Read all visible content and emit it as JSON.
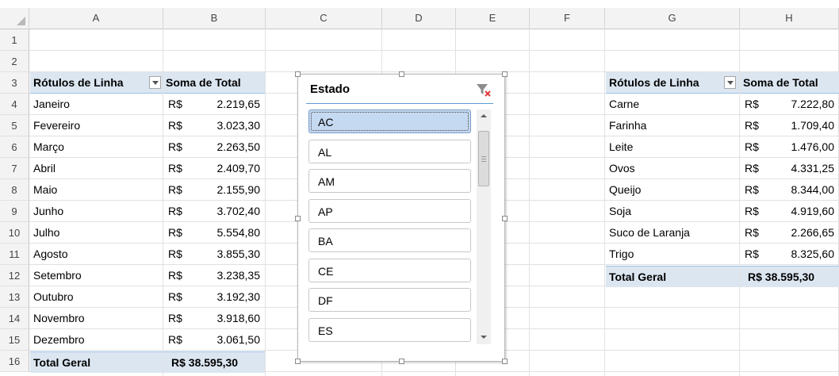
{
  "columns": [
    "A",
    "B",
    "C",
    "D",
    "E",
    "F",
    "G",
    "H"
  ],
  "rows": [
    "1",
    "2",
    "3",
    "4",
    "5",
    "6",
    "7",
    "8",
    "9",
    "10",
    "11",
    "12",
    "13",
    "14",
    "15",
    "16"
  ],
  "pivot_months": {
    "header_label": "Rótulos de Linha",
    "header_value": "Soma de Total",
    "currency": "R$",
    "items": [
      {
        "label": "Janeiro",
        "value": "2.219,65"
      },
      {
        "label": "Fevereiro",
        "value": "3.023,30"
      },
      {
        "label": "Março",
        "value": "2.263,50"
      },
      {
        "label": "Abril",
        "value": "2.409,70"
      },
      {
        "label": "Maio",
        "value": "2.155,90"
      },
      {
        "label": "Junho",
        "value": "3.702,40"
      },
      {
        "label": "Julho",
        "value": "5.554,80"
      },
      {
        "label": "Agosto",
        "value": "3.855,30"
      },
      {
        "label": "Setembro",
        "value": "3.238,35"
      },
      {
        "label": "Outubro",
        "value": "3.192,30"
      },
      {
        "label": "Novembro",
        "value": "3.918,60"
      },
      {
        "label": "Dezembro",
        "value": "3.061,50"
      }
    ],
    "total_label": "Total Geral",
    "total_value": "R$  38.595,30"
  },
  "pivot_products": {
    "header_label": "Rótulos de Linha",
    "header_value": "Soma de Total",
    "currency": "R$",
    "items": [
      {
        "label": "Carne",
        "value": "7.222,80"
      },
      {
        "label": "Farinha",
        "value": "1.709,40"
      },
      {
        "label": "Leite",
        "value": "1.476,00"
      },
      {
        "label": "Ovos",
        "value": "4.331,25"
      },
      {
        "label": "Queijo",
        "value": "8.344,00"
      },
      {
        "label": "Soja",
        "value": "4.919,60"
      },
      {
        "label": "Suco de Laranja",
        "value": "2.266,65"
      },
      {
        "label": "Trigo",
        "value": "8.325,60"
      }
    ],
    "total_label": "Total Geral",
    "total_value": "R$  38.595,30"
  },
  "slicer": {
    "title": "Estado",
    "selected": "AC",
    "items": [
      "AC",
      "AL",
      "AM",
      "AP",
      "BA",
      "CE",
      "DF",
      "ES"
    ]
  },
  "icons": {
    "clear_filter": "clear-filter-icon",
    "dropdown": "dropdown-arrow-icon"
  },
  "colors": {
    "pivot_header_bg": "#dce6f1",
    "slicer_selected_bg": "#c5d9f1",
    "slicer_line": "#5b9bd5",
    "clear_filter_x": "#e03a3a"
  }
}
